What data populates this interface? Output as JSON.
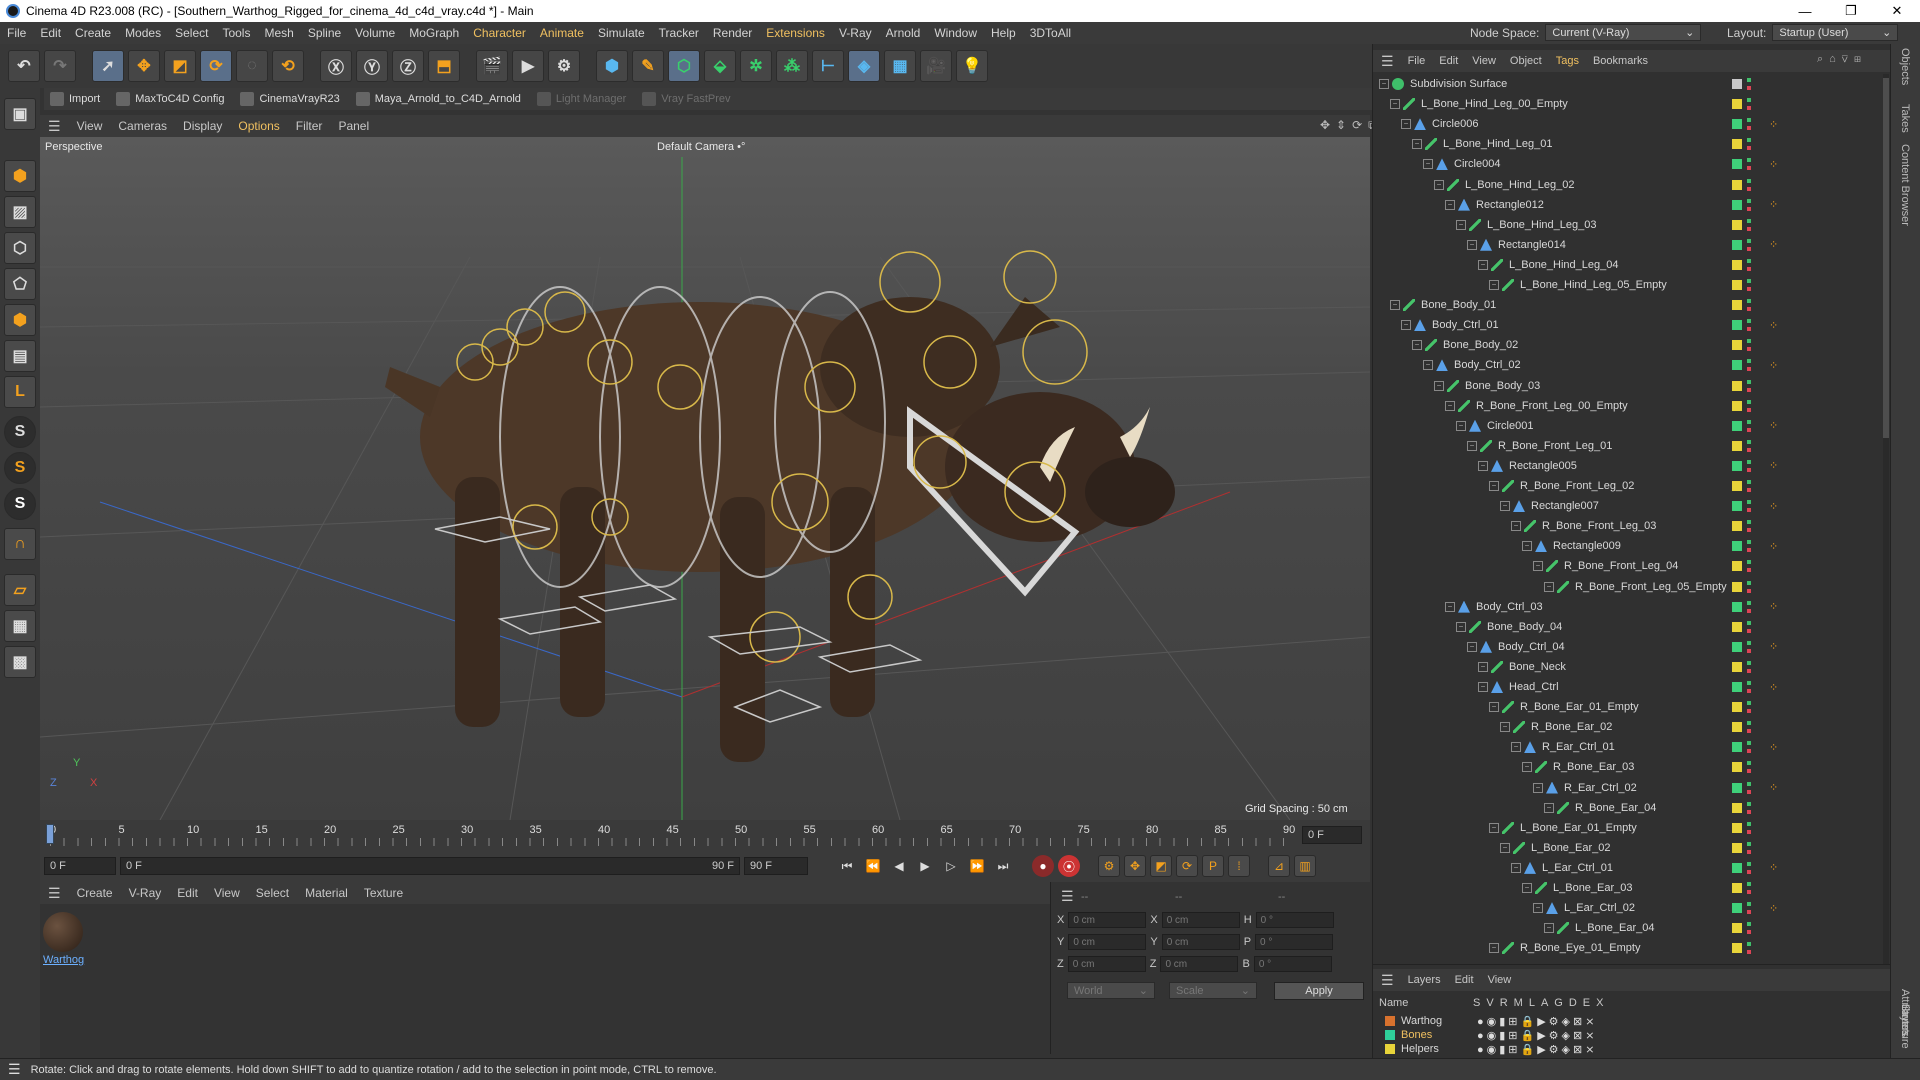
{
  "window": {
    "title": "Cinema 4D R23.008 (RC) - [Southern_Warthog_Rigged_for_cinema_4d_c4d_vray.c4d *] - Main",
    "min": "—",
    "max": "❐",
    "close": "✕"
  },
  "menu": [
    "File",
    "Edit",
    "Create",
    "Modes",
    "Select",
    "Tools",
    "Mesh",
    "Spline",
    "Volume",
    "MoGraph",
    "Character",
    "Animate",
    "Simulate",
    "Tracker",
    "Render",
    "Extensions",
    "V-Ray",
    "Arnold",
    "Window",
    "Help",
    "3DToAll"
  ],
  "node_space": {
    "label": "Node Space:",
    "value": "Current (V-Ray)"
  },
  "layout": {
    "label": "Layout:",
    "value": "Startup (User)"
  },
  "plugins": [
    {
      "label": "Import",
      "dim": false
    },
    {
      "label": "MaxToC4D Config",
      "dim": false
    },
    {
      "label": "CinemaVrayR23",
      "dim": false
    },
    {
      "label": "Maya_Arnold_to_C4D_Arnold",
      "dim": false
    },
    {
      "label": "Light Manager",
      "dim": true
    },
    {
      "label": "Vray FastPrev",
      "dim": true
    }
  ],
  "view_menu": [
    "View",
    "Cameras",
    "Display",
    "Options",
    "Filter",
    "Panel"
  ],
  "viewport": {
    "name": "Perspective",
    "camera": "Default Camera",
    "camera_marker": "•°",
    "grid_spacing": "Grid Spacing : 50 cm",
    "axis_x": "X",
    "axis_y": "Y",
    "axis_z": "Z"
  },
  "timeline": {
    "ticks": [
      "0",
      "5",
      "10",
      "15",
      "20",
      "25",
      "30",
      "35",
      "40",
      "45",
      "50",
      "55",
      "60",
      "65",
      "70",
      "75",
      "80",
      "85",
      "90"
    ],
    "current_frame": "0 F",
    "start": "0 F",
    "slider_start": "0 F",
    "slider_end": "90 F",
    "end": "90 F"
  },
  "material_menu": [
    "Create",
    "V-Ray",
    "Edit",
    "View",
    "Select",
    "Material",
    "Texture"
  ],
  "material": {
    "name": "Warthog"
  },
  "coords": {
    "header_a": "--",
    "header_b": "--",
    "header_c": "--",
    "rows": [
      {
        "a": "X",
        "va": "0 cm",
        "b": "X",
        "vb": "0 cm",
        "c": "H",
        "vc": "0 °"
      },
      {
        "a": "Y",
        "va": "0 cm",
        "b": "Y",
        "vb": "0 cm",
        "c": "P",
        "vc": "0 °"
      },
      {
        "a": "Z",
        "va": "0 cm",
        "b": "Z",
        "vb": "0 cm",
        "c": "B",
        "vc": "0 °"
      }
    ],
    "mode": "World",
    "scale": "Scale",
    "apply": "Apply"
  },
  "object_menu": [
    "File",
    "Edit",
    "View",
    "Object",
    "Tags",
    "Bookmarks"
  ],
  "objects": [
    {
      "name": "Subdivision Surface",
      "depth": 0,
      "icon": "sub",
      "color": "#c8c8c8",
      "tag": false
    },
    {
      "name": "L_Bone_Hind_Leg_00_Empty",
      "depth": 1,
      "icon": "bone",
      "color": "#e8d43a",
      "tag": false
    },
    {
      "name": "Circle006",
      "depth": 2,
      "icon": "spline",
      "color": "#3fd07a",
      "tag": true
    },
    {
      "name": "L_Bone_Hind_Leg_01",
      "depth": 3,
      "icon": "bone",
      "color": "#e8d43a",
      "tag": false
    },
    {
      "name": "Circle004",
      "depth": 4,
      "icon": "spline",
      "color": "#3fd07a",
      "tag": true
    },
    {
      "name": "L_Bone_Hind_Leg_02",
      "depth": 5,
      "icon": "bone",
      "color": "#e8d43a",
      "tag": false
    },
    {
      "name": "Rectangle012",
      "depth": 6,
      "icon": "spline",
      "color": "#3fd07a",
      "tag": true
    },
    {
      "name": "L_Bone_Hind_Leg_03",
      "depth": 7,
      "icon": "bone",
      "color": "#e8d43a",
      "tag": false
    },
    {
      "name": "Rectangle014",
      "depth": 8,
      "icon": "spline",
      "color": "#3fd07a",
      "tag": true
    },
    {
      "name": "L_Bone_Hind_Leg_04",
      "depth": 9,
      "icon": "bone",
      "color": "#e8d43a",
      "tag": false
    },
    {
      "name": "L_Bone_Hind_Leg_05_Empty",
      "depth": 10,
      "icon": "bone",
      "color": "#e8d43a",
      "tag": false
    },
    {
      "name": "Bone_Body_01",
      "depth": 1,
      "icon": "bone",
      "color": "#e8d43a",
      "tag": false
    },
    {
      "name": "Body_Ctrl_01",
      "depth": 2,
      "icon": "spline",
      "color": "#3fd07a",
      "tag": true
    },
    {
      "name": "Bone_Body_02",
      "depth": 3,
      "icon": "bone",
      "color": "#e8d43a",
      "tag": false
    },
    {
      "name": "Body_Ctrl_02",
      "depth": 4,
      "icon": "spline",
      "color": "#3fd07a",
      "tag": true
    },
    {
      "name": "Bone_Body_03",
      "depth": 5,
      "icon": "bone",
      "color": "#e8d43a",
      "tag": false
    },
    {
      "name": "R_Bone_Front_Leg_00_Empty",
      "depth": 6,
      "icon": "bone",
      "color": "#e8d43a",
      "tag": false
    },
    {
      "name": "Circle001",
      "depth": 7,
      "icon": "spline",
      "color": "#3fd07a",
      "tag": true
    },
    {
      "name": "R_Bone_Front_Leg_01",
      "depth": 8,
      "icon": "bone",
      "color": "#e8d43a",
      "tag": false
    },
    {
      "name": "Rectangle005",
      "depth": 9,
      "icon": "spline",
      "color": "#3fd07a",
      "tag": true
    },
    {
      "name": "R_Bone_Front_Leg_02",
      "depth": 10,
      "icon": "bone",
      "color": "#e8d43a",
      "tag": false
    },
    {
      "name": "Rectangle007",
      "depth": 11,
      "icon": "spline",
      "color": "#3fd07a",
      "tag": true
    },
    {
      "name": "R_Bone_Front_Leg_03",
      "depth": 12,
      "icon": "bone",
      "color": "#e8d43a",
      "tag": false
    },
    {
      "name": "Rectangle009",
      "depth": 13,
      "icon": "spline",
      "color": "#3fd07a",
      "tag": true
    },
    {
      "name": "R_Bone_Front_Leg_04",
      "depth": 14,
      "icon": "bone",
      "color": "#e8d43a",
      "tag": false
    },
    {
      "name": "R_Bone_Front_Leg_05_Empty",
      "depth": 15,
      "icon": "bone",
      "color": "#e8d43a",
      "tag": false
    },
    {
      "name": "Body_Ctrl_03",
      "depth": 6,
      "icon": "spline",
      "color": "#3fd07a",
      "tag": true
    },
    {
      "name": "Bone_Body_04",
      "depth": 7,
      "icon": "bone",
      "color": "#e8d43a",
      "tag": false
    },
    {
      "name": "Body_Ctrl_04",
      "depth": 8,
      "icon": "spline",
      "color": "#3fd07a",
      "tag": true
    },
    {
      "name": "Bone_Neck",
      "depth": 9,
      "icon": "bone",
      "color": "#e8d43a",
      "tag": false
    },
    {
      "name": "Head_Ctrl",
      "depth": 9,
      "icon": "spline",
      "color": "#3fd07a",
      "tag": true
    },
    {
      "name": "R_Bone_Ear_01_Empty",
      "depth": 10,
      "icon": "bone",
      "color": "#e8d43a",
      "tag": false
    },
    {
      "name": "R_Bone_Ear_02",
      "depth": 11,
      "icon": "bone",
      "color": "#e8d43a",
      "tag": false
    },
    {
      "name": "R_Ear_Ctrl_01",
      "depth": 12,
      "icon": "spline",
      "color": "#3fd07a",
      "tag": true
    },
    {
      "name": "R_Bone_Ear_03",
      "depth": 13,
      "icon": "bone",
      "color": "#e8d43a",
      "tag": false
    },
    {
      "name": "R_Ear_Ctrl_02",
      "depth": 14,
      "icon": "spline",
      "color": "#3fd07a",
      "tag": true
    },
    {
      "name": "R_Bone_Ear_04",
      "depth": 15,
      "icon": "bone",
      "color": "#e8d43a",
      "tag": false
    },
    {
      "name": "L_Bone_Ear_01_Empty",
      "depth": 10,
      "icon": "bone",
      "color": "#e8d43a",
      "tag": false
    },
    {
      "name": "L_Bone_Ear_02",
      "depth": 11,
      "icon": "bone",
      "color": "#e8d43a",
      "tag": false
    },
    {
      "name": "L_Ear_Ctrl_01",
      "depth": 12,
      "icon": "spline",
      "color": "#3fd07a",
      "tag": true
    },
    {
      "name": "L_Bone_Ear_03",
      "depth": 13,
      "icon": "bone",
      "color": "#e8d43a",
      "tag": false
    },
    {
      "name": "L_Ear_Ctrl_02",
      "depth": 14,
      "icon": "spline",
      "color": "#3fd07a",
      "tag": true
    },
    {
      "name": "L_Bone_Ear_04",
      "depth": 15,
      "icon": "bone",
      "color": "#e8d43a",
      "tag": false
    },
    {
      "name": "R_Bone_Eye_01_Empty",
      "depth": 10,
      "icon": "bone",
      "color": "#e8d43a",
      "tag": false
    }
  ],
  "layer_menu": [
    "Layers",
    "Edit",
    "View"
  ],
  "layer_cols": {
    "name": "Name",
    "flags": [
      "S",
      "V",
      "R",
      "M",
      "L",
      "A",
      "G",
      "D",
      "E",
      "X"
    ]
  },
  "layers": [
    {
      "name": "Warthog",
      "color": "#d8722e",
      "text_color": "#d8d8d8"
    },
    {
      "name": "Bones",
      "color": "#2fcf9a",
      "text_color": "#f0c060"
    },
    {
      "name": "Helpers",
      "color": "#e8d43a",
      "text_color": "#d8d8d8"
    }
  ],
  "right_tabs": [
    "Objects",
    "Takes",
    "Content Browser",
    "Attributes",
    "Layers",
    "Structure"
  ],
  "status": "Rotate: Click and drag to rotate elements. Hold down SHIFT to add to quantize rotation / add to the selection in point mode, CTRL to remove."
}
